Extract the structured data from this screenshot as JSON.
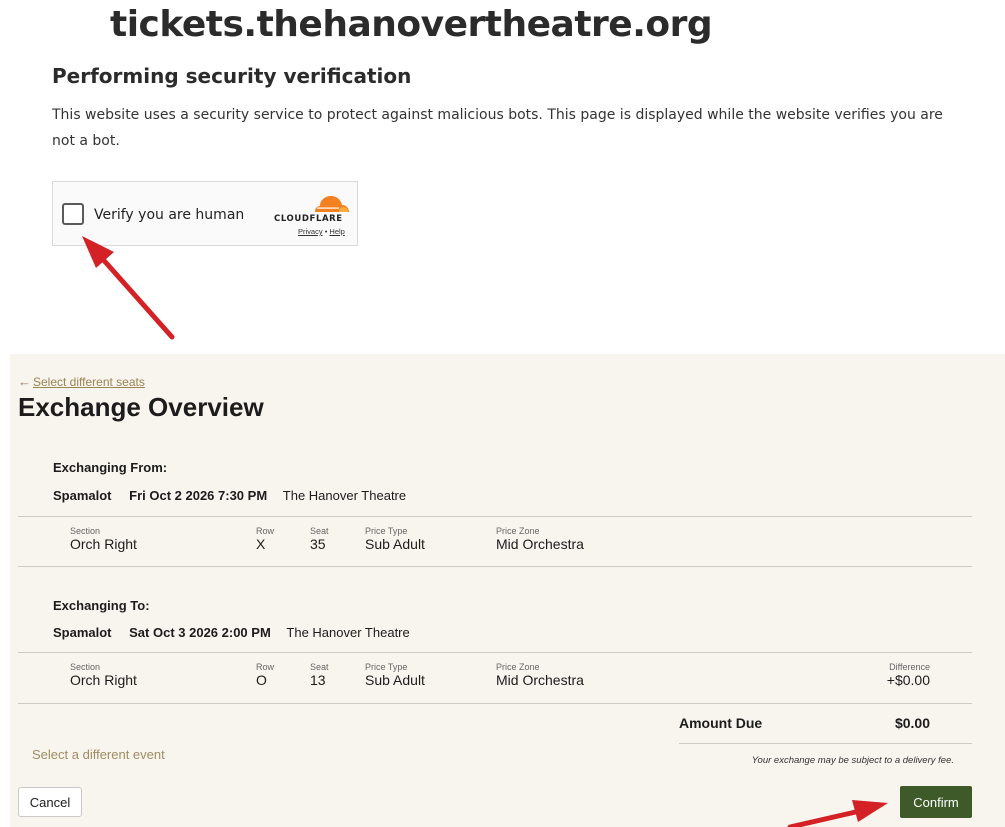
{
  "security": {
    "domain": "tickets.thehanovertheatre.org",
    "heading": "Performing security verification",
    "description": "This website uses a security service to protect against malicious bots. This page is displayed while the website verifies you are not a bot.",
    "widget": {
      "label": "Verify you are human",
      "brand": "CLOUDFLARE",
      "privacy": "Privacy",
      "separator": "•",
      "help": "Help"
    }
  },
  "exchange": {
    "back_link": "Select different seats",
    "back_arrow": "←",
    "title": "Exchange Overview",
    "from": {
      "heading": "Exchanging From:",
      "show": "Spamalot",
      "datetime": "Fri Oct 2 2026 7:30 PM",
      "venue": "The Hanover Theatre",
      "seat": {
        "section_label": "Section",
        "section": "Orch Right",
        "row_label": "Row",
        "row": "X",
        "seat_label": "Seat",
        "seat": "35",
        "price_type_label": "Price Type",
        "price_type": "Sub Adult",
        "price_zone_label": "Price Zone",
        "price_zone": "Mid Orchestra"
      }
    },
    "to": {
      "heading": "Exchanging To:",
      "show": "Spamalot",
      "datetime": "Sat Oct 3 2026 2:00 PM",
      "venue": "The Hanover Theatre",
      "seat": {
        "section_label": "Section",
        "section": "Orch Right",
        "row_label": "Row",
        "row": "O",
        "seat_label": "Seat",
        "seat": "13",
        "price_type_label": "Price Type",
        "price_type": "Sub Adult",
        "price_zone_label": "Price Zone",
        "price_zone": "Mid Orchestra",
        "difference_label": "Difference",
        "difference": "+$0.00"
      }
    },
    "amount_due_label": "Amount Due",
    "amount_due": "$0.00",
    "fee_note": "Your exchange may be subject to a delivery fee.",
    "different_event": "Select a different event",
    "cancel": "Cancel",
    "confirm": "Confirm"
  },
  "colors": {
    "panel_bg": "#f8f5ee",
    "confirm_bg": "#3d5a28",
    "link": "#9a8455",
    "annotation_arrow": "#d42126",
    "cloudflare_orange": "#f48120"
  }
}
